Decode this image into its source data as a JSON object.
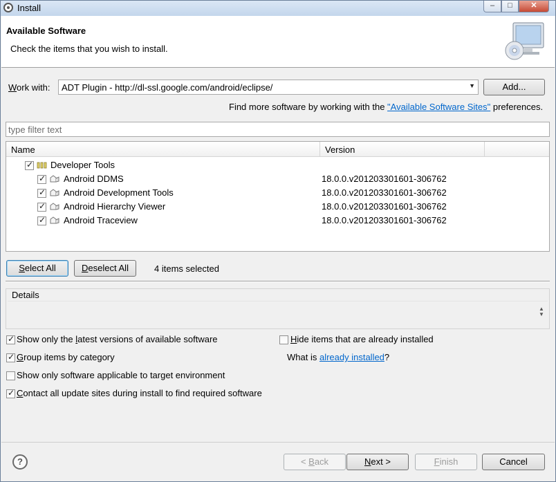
{
  "window": {
    "title": "Install"
  },
  "header": {
    "title": "Available Software",
    "description": "Check the items that you wish to install."
  },
  "work_with": {
    "label_mnemonic": "W",
    "label_rest": "ork with:",
    "value": "ADT Plugin - http://dl-ssl.google.com/android/eclipse/",
    "add_button": "Add..."
  },
  "find_more": {
    "prefix": "Find more software by working with the ",
    "link": "\"Available Software Sites\"",
    "suffix": " preferences."
  },
  "filter": {
    "placeholder": "type filter text"
  },
  "table": {
    "columns": [
      "Name",
      "Version"
    ],
    "category": {
      "label": "Developer Tools",
      "checked": true
    },
    "items": [
      {
        "name": "Android DDMS",
        "version": "18.0.0.v201203301601-306762",
        "checked": true
      },
      {
        "name": "Android Development Tools",
        "version": "18.0.0.v201203301601-306762",
        "checked": true
      },
      {
        "name": "Android Hierarchy Viewer",
        "version": "18.0.0.v201203301601-306762",
        "checked": true
      },
      {
        "name": "Android Traceview",
        "version": "18.0.0.v201203301601-306762",
        "checked": true
      }
    ]
  },
  "selection": {
    "select_all_mnemonic": "S",
    "select_all_rest": "elect All",
    "deselect_all_mnemonic": "D",
    "deselect_all_rest": "eselect All",
    "status": "4 items selected"
  },
  "details": {
    "label": "Details"
  },
  "options": {
    "latest": {
      "pre": "Show only the ",
      "mnemonic": "l",
      "post": "atest versions of available software",
      "checked": true
    },
    "hide": {
      "pre": "",
      "mnemonic": "H",
      "post": "ide items that are already installed",
      "checked": false
    },
    "group": {
      "pre": "",
      "mnemonic": "G",
      "post": "roup items by category",
      "checked": true
    },
    "what_is_prefix": "What is ",
    "already_installed_link": "already installed",
    "what_is_suffix": "?",
    "applicable": {
      "label": "Show only software applicable to target environment",
      "checked": false
    },
    "contact": {
      "pre": "",
      "mnemonic": "C",
      "post": "ontact all update sites during install to find required software",
      "checked": true
    }
  },
  "footer": {
    "help": "?",
    "back_label": "< ",
    "back_mnemonic": "B",
    "back_rest": "ack",
    "next_mnemonic": "N",
    "next_rest": "ext >",
    "finish_mnemonic": "F",
    "finish_rest": "inish",
    "cancel_label": "Cancel"
  }
}
